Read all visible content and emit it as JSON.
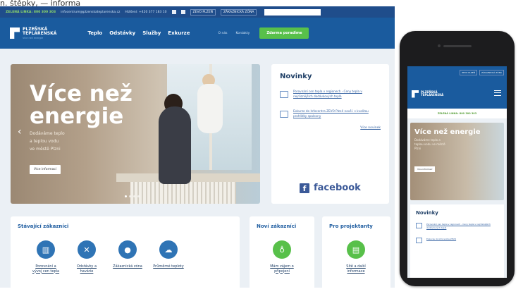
{
  "caption": "n. štěpky, — informa",
  "topbar": {
    "green_line": "ZELENÁ LINKA: 800 300 303",
    "email": "infocentrum@plzenskateplarenska.cz",
    "phone": "Hlášení: +420 377 183 10",
    "btn_plzen": "ZEVO PLZEŇ",
    "btn_zone": "ZÁKAZNICKÁ ZÓNA"
  },
  "nav": {
    "logo_line1": "PLZEŇSKÁ",
    "logo_line2": "TEPLÁRENSKÁ",
    "logo_sub": "Více než energie",
    "menu": [
      "Teplo",
      "Odstávky",
      "Služby",
      "Exkurze"
    ],
    "small_menu": [
      "O nás",
      "Kontakty"
    ],
    "cta": "Zdarma poradíme"
  },
  "hero": {
    "title_line1": "Více než",
    "title_line2": "energie",
    "text_line1": "Dodáváme teplo",
    "text_line2": "a teplou vodu",
    "text_line3": "ve městě Plzni",
    "button": "Více informací"
  },
  "news": {
    "title": "Novinky",
    "items": [
      "Porovnání cen tepla v regionech - Ceny tepla v nejrůznějších dodávkových teplá",
      "Exkurze do Infocentra ZEVO Plzeň nově i s kvalitou prohlídky spalovny"
    ],
    "more": "Více novinek",
    "facebook": "facebook"
  },
  "cards": {
    "existing": {
      "title": "Stávající zákazníci",
      "items": [
        {
          "label": "Porovnání a vývoj cen tepla",
          "icon": "chart-icon"
        },
        {
          "label": "Odstávky a havárie",
          "icon": "tools-icon"
        },
        {
          "label": "Zákaznická zóna",
          "icon": "user-icon"
        },
        {
          "label": "Průměrné teploty",
          "icon": "thermometer-icon"
        }
      ]
    },
    "new": {
      "title": "Noví zákazníci",
      "items": [
        {
          "label": "Mám zájem o připojení",
          "icon": "plug-icon"
        }
      ]
    },
    "designers": {
      "title": "Pro projektanty",
      "items": [
        {
          "label": "Sítě a další informace",
          "icon": "document-icon"
        }
      ]
    }
  },
  "phone": {
    "top_btn1": "ZEVO PLZEŇ",
    "top_btn2": "ZÁKAZNICKÁ ZÓNA",
    "logo_line1": "PLZEŇSKÁ",
    "logo_line2": "TEPLÁRENSKÁ",
    "green_line": "ZELENÁ LINKA: 800 300 303",
    "hero_title": "Více než energie",
    "hero_text": "Dodáváme teplo a teplou vodu ve městě Plzni",
    "hero_button": "Více informací",
    "news_title": "Novinky",
    "news_items": [
      "Porovnání cen tepla v regionech - Ceny tepla v nejrůznějších dodávkových teplá",
      "Exkurze do Infocentra ZEVO"
    ]
  },
  "colors": {
    "brand_blue": "#1a5b9e",
    "topbar_blue": "#1f4d8b",
    "accent_green": "#58c04a",
    "link_blue": "#3b67a5"
  }
}
